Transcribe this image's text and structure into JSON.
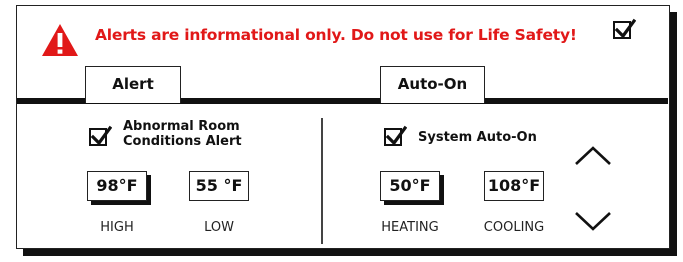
{
  "banner": {
    "text": "Alerts are informational only. Do not use for Life Safety!",
    "color": "#e11818",
    "icon": "warning-triangle-icon",
    "top_checkbox_checked": true
  },
  "tabs": [
    {
      "label": "Alert"
    },
    {
      "label": "Auto-On"
    }
  ],
  "alert_section": {
    "checkbox_checked": true,
    "label_line1": "Abnormal Room",
    "label_line2": "Conditions Alert",
    "high": {
      "value": "98°F",
      "caption": "HIGH"
    },
    "low": {
      "value": "55 °F",
      "caption": "LOW"
    }
  },
  "auto_on_section": {
    "checkbox_checked": true,
    "label": "System Auto-On",
    "heating": {
      "value": "50°F",
      "caption": "HEATING"
    },
    "cooling": {
      "value": "108°F",
      "caption": "COOLING"
    },
    "up_icon": "chevron-up-icon",
    "down_icon": "chevron-down-icon"
  }
}
